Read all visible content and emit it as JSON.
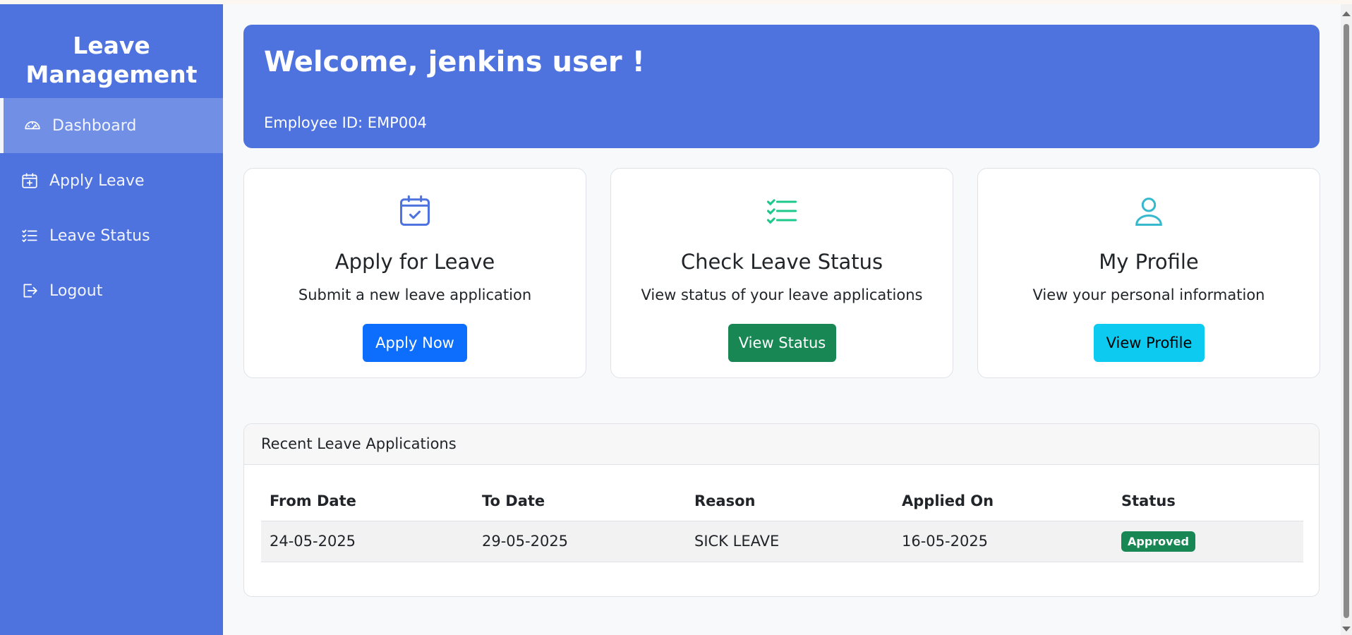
{
  "sidebar": {
    "brand_line1": "Leave",
    "brand_line2": "Management",
    "items": [
      {
        "label": "Dashboard",
        "icon": "speedometer-icon"
      },
      {
        "label": "Apply Leave",
        "icon": "calendar-plus-icon"
      },
      {
        "label": "Leave Status",
        "icon": "list-check-icon"
      },
      {
        "label": "Logout",
        "icon": "logout-icon"
      }
    ]
  },
  "welcome": {
    "title": "Welcome, jenkins user !",
    "employee_id": "Employee ID: EMP004"
  },
  "cards": [
    {
      "title": "Apply for Leave",
      "description": "Submit a new leave application",
      "button": "Apply Now",
      "icon": "calendar-check-icon",
      "icon_color": "#4e73df",
      "button_color": "#0d6efd"
    },
    {
      "title": "Check Leave Status",
      "description": "View status of your leave applications",
      "button": "View Status",
      "icon": "list-check-icon",
      "icon_color": "#1cc88a",
      "button_color": "#198754"
    },
    {
      "title": "My Profile",
      "description": "View your personal information",
      "button": "View Profile",
      "icon": "person-icon",
      "icon_color": "#36b9cc",
      "button_color": "#0dcaf0"
    }
  ],
  "recent": {
    "title": "Recent Leave Applications",
    "columns": [
      "From Date",
      "To Date",
      "Reason",
      "Applied On",
      "Status"
    ],
    "rows": [
      {
        "from": "24-05-2025",
        "to": "29-05-2025",
        "reason": "SICK LEAVE",
        "applied": "16-05-2025",
        "status": "Approved"
      }
    ]
  },
  "colors": {
    "primary": "#4e73df",
    "success": "#198754",
    "info": "#0dcaf0"
  }
}
